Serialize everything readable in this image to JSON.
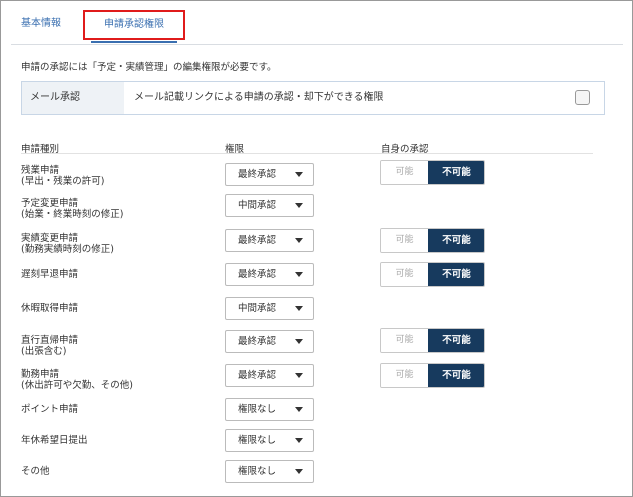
{
  "tabs": [
    {
      "label": "基本情報"
    },
    {
      "label": "申請承認権限"
    }
  ],
  "notice": "申請の承認には「予定・実績管理」の編集権限が必要です。",
  "mail_approval": {
    "label": "メール承認",
    "description": "メール記載リンクによる申請の承認・却下ができる権限",
    "checked": false
  },
  "headers": {
    "type": "申請種別",
    "permission": "権限",
    "self_approval": "自身の承認"
  },
  "rows": [
    {
      "line1": "残業申請",
      "line2": "(早出・残業の許可)",
      "permission": "最終承認",
      "toggle": true
    },
    {
      "line1": "予定変更申請",
      "line2": "(始業・終業時刻の修正)",
      "permission": "中間承認",
      "toggle": false
    },
    {
      "line1": "実績変更申請",
      "line2": "(勤務実績時刻の修正)",
      "permission": "最終承認",
      "toggle": true
    },
    {
      "line1": "遅刻早退申請",
      "line2": "",
      "permission": "最終承認",
      "toggle": true
    },
    {
      "line1": "休暇取得申請",
      "line2": "",
      "permission": "中間承認",
      "toggle": false
    },
    {
      "line1": "直行直帰申請",
      "line2": "(出張含む)",
      "permission": "最終承認",
      "toggle": true
    },
    {
      "line1": "勤務申請",
      "line2": "(休出許可や欠勤、その他)",
      "permission": "最終承認",
      "toggle": true
    },
    {
      "line1": "ポイント申請",
      "line2": "",
      "permission": "権限なし",
      "toggle": false
    },
    {
      "line1": "年休希望日提出",
      "line2": "",
      "permission": "権限なし",
      "toggle": false
    },
    {
      "line1": "その他",
      "line2": "",
      "permission": "権限なし",
      "toggle": false
    }
  ],
  "toggle_labels": {
    "off": "可能",
    "on": "不可能"
  },
  "colors": {
    "accent": "#3a6fb0",
    "toggle_active": "#173a5e",
    "highlight": "#e01b1b"
  }
}
